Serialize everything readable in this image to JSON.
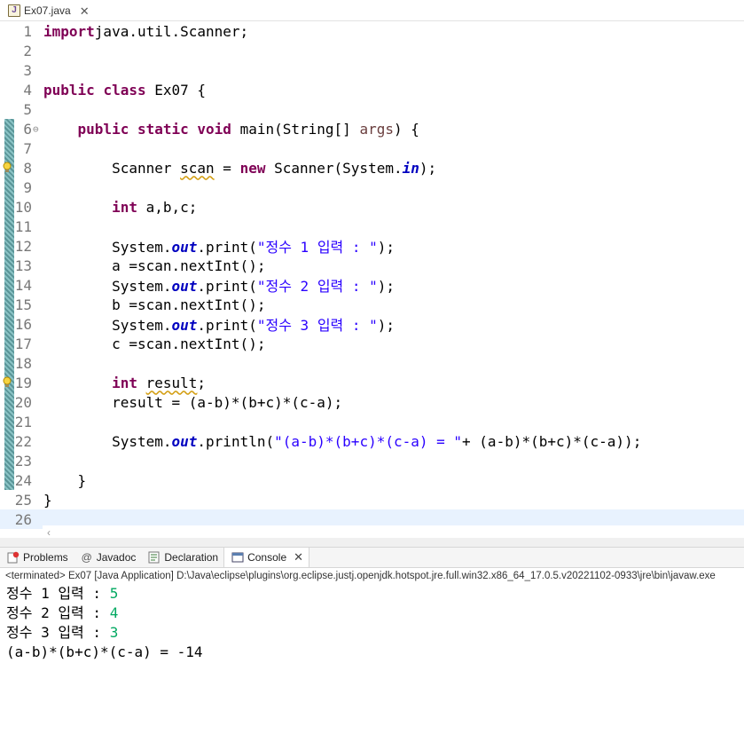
{
  "editor_tab": {
    "label": "Ex07.java",
    "icon": "java-file-icon"
  },
  "code_lines": [
    {
      "n": "1",
      "parts": [
        [
          "kw",
          "import"
        ],
        [
          "",
          "java.util.Scanner;"
        ]
      ]
    },
    {
      "n": "2",
      "parts": []
    },
    {
      "n": "3",
      "parts": []
    },
    {
      "n": "4",
      "parts": [
        [
          "kw",
          "public"
        ],
        [
          "",
          " "
        ],
        [
          "kw",
          "class"
        ],
        [
          "",
          " Ex07 {"
        ]
      ]
    },
    {
      "n": "5",
      "parts": []
    },
    {
      "n": "6",
      "fold": "⊖",
      "parts": [
        [
          "",
          "    "
        ],
        [
          "kw",
          "public"
        ],
        [
          "",
          " "
        ],
        [
          "kw",
          "static"
        ],
        [
          "",
          " "
        ],
        [
          "kw",
          "void"
        ],
        [
          "",
          " main(String[] "
        ],
        [
          "prm",
          "args"
        ],
        [
          "",
          ") {"
        ]
      ]
    },
    {
      "n": "7",
      "parts": []
    },
    {
      "n": "8",
      "parts": [
        [
          "",
          "        Scanner "
        ],
        [
          "warnul",
          "scan"
        ],
        [
          "",
          " = "
        ],
        [
          "kw",
          "new"
        ],
        [
          "",
          " Scanner(System."
        ],
        [
          "fld",
          "in"
        ],
        [
          "",
          ");"
        ]
      ]
    },
    {
      "n": "9",
      "parts": []
    },
    {
      "n": "10",
      "parts": [
        [
          "",
          "        "
        ],
        [
          "kw",
          "int"
        ],
        [
          "",
          " a,b,c;"
        ]
      ]
    },
    {
      "n": "11",
      "parts": []
    },
    {
      "n": "12",
      "parts": [
        [
          "",
          "        System."
        ],
        [
          "fld",
          "out"
        ],
        [
          "",
          ".print("
        ],
        [
          "str",
          "\"정수 1 입력 : \""
        ],
        [
          "",
          ");"
        ]
      ]
    },
    {
      "n": "13",
      "parts": [
        [
          "",
          "        a =scan.nextInt();"
        ]
      ]
    },
    {
      "n": "14",
      "parts": [
        [
          "",
          "        System."
        ],
        [
          "fld",
          "out"
        ],
        [
          "",
          ".print("
        ],
        [
          "str",
          "\"정수 2 입력 : \""
        ],
        [
          "",
          ");"
        ]
      ]
    },
    {
      "n": "15",
      "parts": [
        [
          "",
          "        b =scan.nextInt();"
        ]
      ]
    },
    {
      "n": "16",
      "parts": [
        [
          "",
          "        System."
        ],
        [
          "fld",
          "out"
        ],
        [
          "",
          ".print("
        ],
        [
          "str",
          "\"정수 3 입력 : \""
        ],
        [
          "",
          ");"
        ]
      ]
    },
    {
      "n": "17",
      "parts": [
        [
          "",
          "        c =scan.nextInt();"
        ]
      ]
    },
    {
      "n": "18",
      "parts": []
    },
    {
      "n": "19",
      "parts": [
        [
          "",
          "        "
        ],
        [
          "kw",
          "int"
        ],
        [
          "",
          " "
        ],
        [
          "warnul",
          "result"
        ],
        [
          "",
          ";"
        ]
      ]
    },
    {
      "n": "20",
      "parts": [
        [
          "",
          "        result = (a-b)*(b+c)*(c-a);"
        ]
      ]
    },
    {
      "n": "21",
      "parts": []
    },
    {
      "n": "22",
      "parts": [
        [
          "",
          "        System."
        ],
        [
          "fld",
          "out"
        ],
        [
          "",
          ".println("
        ],
        [
          "str",
          "\"(a-b)*(b+c)*(c-a) = \""
        ],
        [
          "",
          "+ (a-b)*(b+c)*(c-a));"
        ]
      ]
    },
    {
      "n": "23",
      "parts": []
    },
    {
      "n": "24",
      "parts": [
        [
          "",
          "    }"
        ]
      ]
    },
    {
      "n": "25",
      "parts": [
        [
          "",
          "}"
        ]
      ]
    },
    {
      "n": "26",
      "parts": [],
      "current": true
    }
  ],
  "panel_tabs": [
    {
      "label": "Problems",
      "icon": "problems-icon"
    },
    {
      "label": "Javadoc",
      "icon": "javadoc-icon"
    },
    {
      "label": "Declaration",
      "icon": "declaration-icon"
    },
    {
      "label": "Console",
      "icon": "console-icon",
      "active": true
    }
  ],
  "console": {
    "header": "<terminated> Ex07 [Java Application] D:\\Java\\eclipse\\plugins\\org.eclipse.justj.openjdk.hotspot.jre.full.win32.x86_64_17.0.5.v20221102-0933\\jre\\bin\\javaw.exe",
    "lines": [
      {
        "text": "정수 1 입력 : ",
        "input": "5"
      },
      {
        "text": "정수 2 입력 : ",
        "input": "4"
      },
      {
        "text": "정수 3 입력 : ",
        "input": "3"
      },
      {
        "text": "(a-b)*(b+c)*(c-a) = -14",
        "input": ""
      }
    ]
  },
  "colors": {
    "keyword": "#7f0055",
    "string": "#2a00ff",
    "static_field": "#0000c0",
    "parameter": "#6a3e3e",
    "console_input": "#00a860",
    "current_line": "#e8f2fe"
  }
}
